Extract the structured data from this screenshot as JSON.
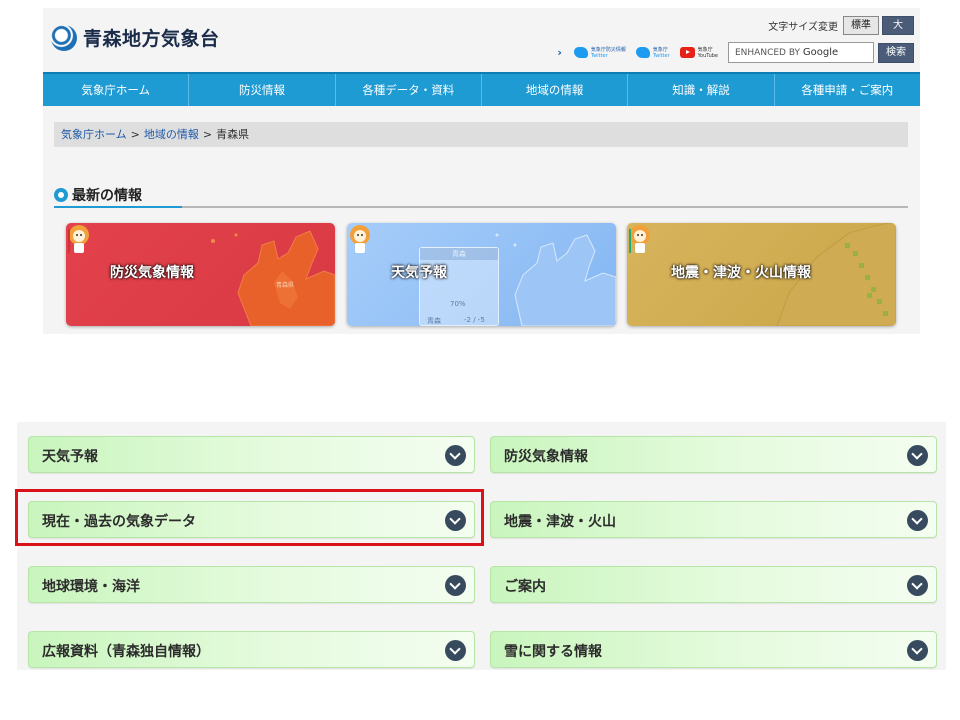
{
  "site": {
    "logo_title": "青森地方気象台",
    "font_size": {
      "label": "文字サイズ変更",
      "standard": "標準",
      "large": "大"
    },
    "sns": [
      {
        "line1": "気象庁防災情報",
        "line2": "Twitter"
      },
      {
        "line1": "気象庁",
        "line2": "Twitter"
      },
      {
        "line1": "気象庁",
        "line2": "YouTube"
      }
    ],
    "search": {
      "prefix": "ENHANCED BY",
      "brand": "Google",
      "button": "検索"
    },
    "nav": [
      "気象庁ホーム",
      "防災情報",
      "各種データ・資料",
      "地域の情報",
      "知識・解説",
      "各種申請・ご案内"
    ],
    "breadcrumb": {
      "home": "気象庁ホーム",
      "sep": ">",
      "region": "地域の情報",
      "current": "青森県"
    },
    "latest_title": "最新の情報",
    "cards": [
      {
        "label": "防災気象情報",
        "map_label": "青森県",
        "color": "#e3424c"
      },
      {
        "label": "天気予報",
        "color": "#a6cdfa",
        "widget": {
          "header": "青森",
          "pop": "70%",
          "city": "青森",
          "temps": "-2 / -5"
        }
      },
      {
        "label": "地震・津波・火山情報",
        "color": "#d7b45c"
      }
    ]
  },
  "menu": {
    "items": [
      {
        "label": "天気予報"
      },
      {
        "label": "防災気象情報"
      },
      {
        "label": "現在・過去の気象データ"
      },
      {
        "label": "地震・津波・火山"
      },
      {
        "label": "地球環境・海洋"
      },
      {
        "label": "ご案内"
      },
      {
        "label": "広報資料（青森独自情報）"
      },
      {
        "label": "雪に関する情報"
      }
    ],
    "highlight_color": "#d81218",
    "button_color": "#c9f5bd"
  }
}
